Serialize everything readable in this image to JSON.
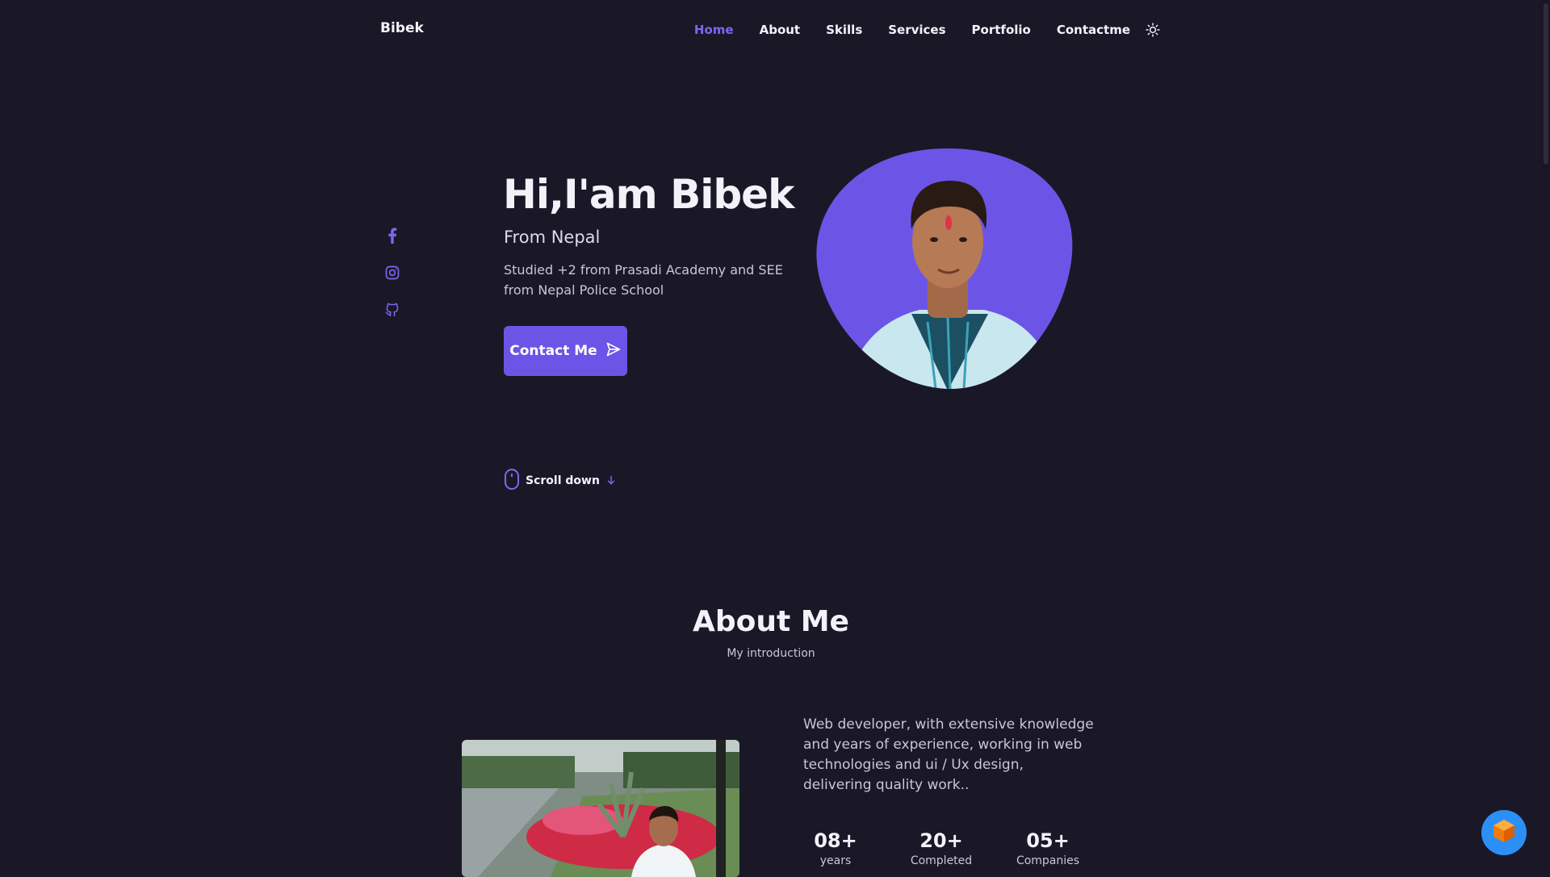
{
  "header": {
    "brand": "Bibek",
    "nav": [
      {
        "label": "Home",
        "active": true
      },
      {
        "label": "About"
      },
      {
        "label": "Skills"
      },
      {
        "label": "Services"
      },
      {
        "label": "Portfolio"
      },
      {
        "label": "Contactme"
      }
    ],
    "theme_icon": "sun-icon"
  },
  "social": {
    "icons": [
      "facebook-icon",
      "instagram-icon",
      "github-icon"
    ]
  },
  "hero": {
    "title": "Hi,I'am Bibek",
    "subtitle": "From Nepal",
    "description": "Studied +2 from Prasadi Academy and SEE from Nepal Police School",
    "cta_label": "Contact Me",
    "cta_icon": "send-icon",
    "scroll_label": "Scroll down",
    "scroll_icons": [
      "mouse-icon",
      "arrow-down-icon"
    ]
  },
  "about": {
    "title": "About Me",
    "subtitle": "My introduction",
    "text": "Web developer, with extensive knowledge and years of experience, working in web technologies and ui / Ux design, delivering quality work..",
    "stats": [
      {
        "num": "08+",
        "caption": "years"
      },
      {
        "num": "20+",
        "caption": "Completed"
      },
      {
        "num": "05+",
        "caption": "Companies"
      }
    ]
  },
  "colors": {
    "background": "#1a1827",
    "accent": "#6c55e6",
    "accent_text": "#7a68f0",
    "text": "#f3f2f9",
    "muted": "#c9c6d8"
  }
}
